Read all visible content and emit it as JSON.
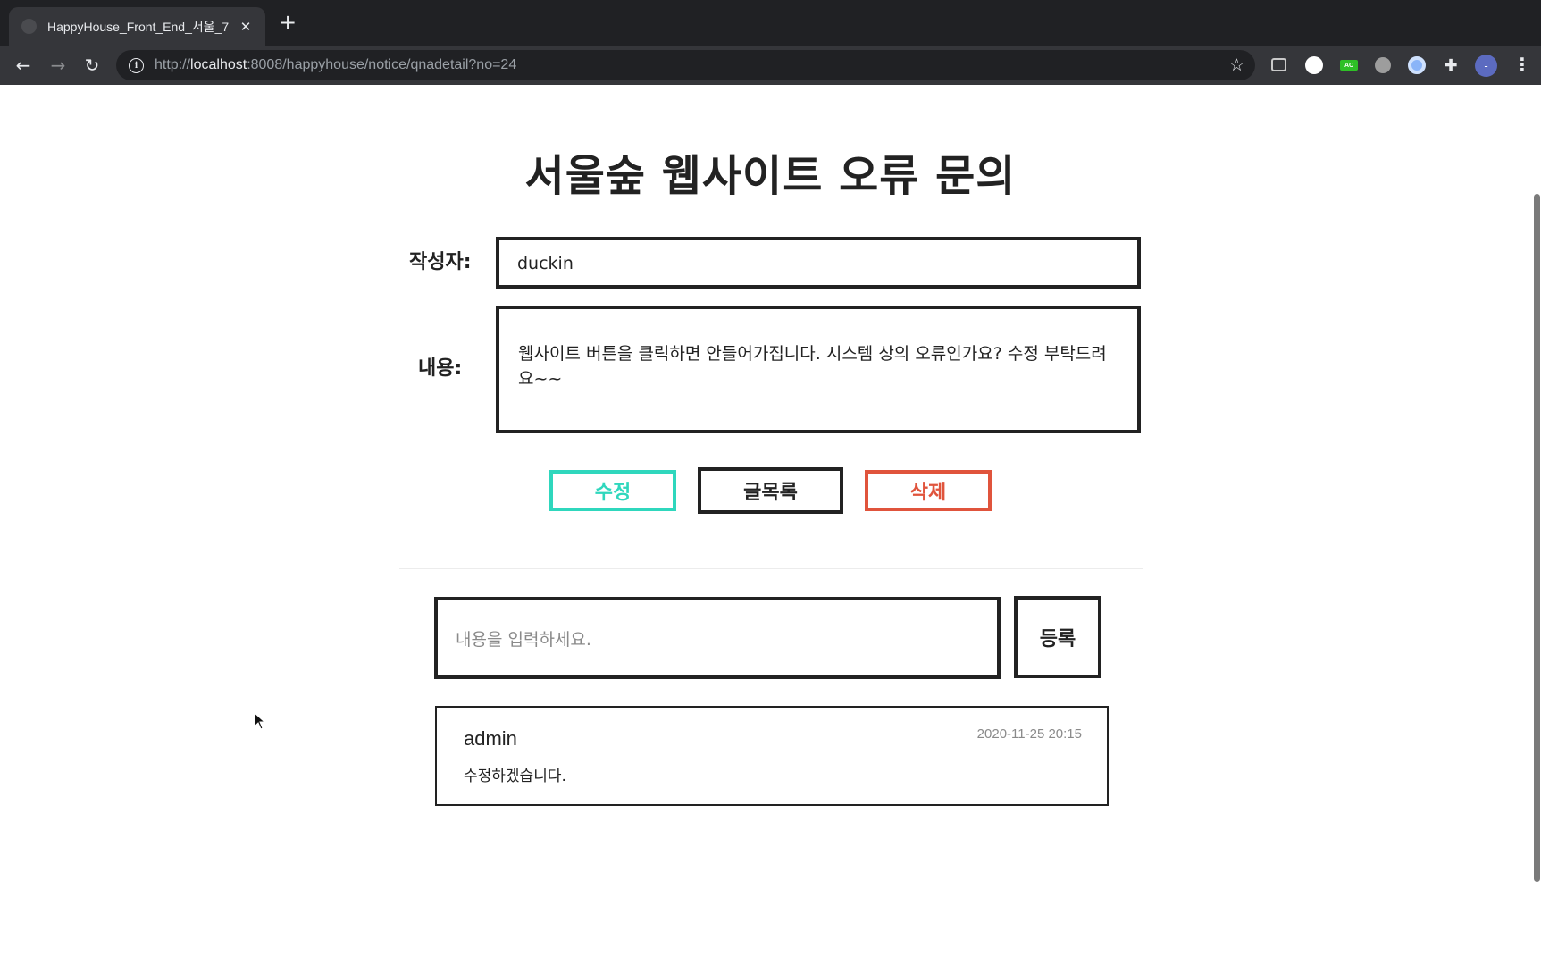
{
  "browser": {
    "tab_title": "HappyHouse_Front_End_서울_7",
    "tab_close": "✕",
    "new_tab": "+",
    "url_scheme": "http://",
    "url_host": "localhost",
    "url_rest": ":8008/happyhouse/notice/qnadetail?no=24",
    "extension_badge": "AC",
    "profile_initial": "-"
  },
  "page": {
    "title": "서울숲 웹사이트 오류 문의",
    "author_label": "작성자:",
    "author_value": "duckin",
    "content_label": "내용:",
    "content_value": "웹사이트 버튼을 클릭하면 안들어가집니다. 시스템 상의 오류인가요? 수정 부탁드려요~~",
    "buttons": {
      "edit": "수정",
      "list": "글목록",
      "delete": "삭제"
    },
    "comment_form": {
      "placeholder": "내용을 입력하세요.",
      "submit": "등록"
    },
    "comments": [
      {
        "author": "admin",
        "date": "2020-11-25 20:15",
        "body": "수정하겠습니다."
      }
    ]
  },
  "colors": {
    "edit": "#2fd7bd",
    "delete": "#e0543c",
    "text": "#222222"
  }
}
